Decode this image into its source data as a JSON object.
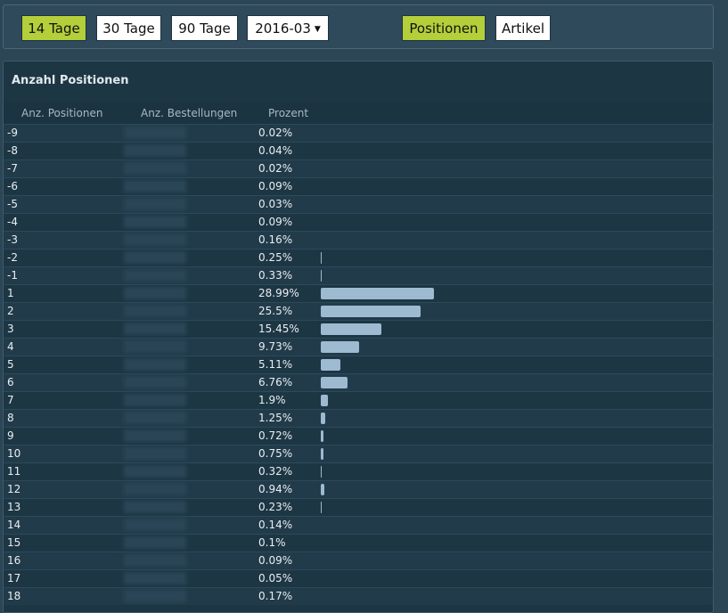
{
  "toolbar": {
    "range_buttons": [
      {
        "label": "14 Tage",
        "active": true
      },
      {
        "label": "30 Tage",
        "active": false
      },
      {
        "label": "90 Tage",
        "active": false
      }
    ],
    "month_select": {
      "value": "2016-03"
    },
    "view_buttons": [
      {
        "label": "Positionen",
        "active": true
      },
      {
        "label": "Artikel",
        "active": false
      }
    ]
  },
  "panel": {
    "title": "Anzahl Positionen",
    "columns": [
      "Anz. Positionen",
      "Anz. Bestellungen",
      "Prozent"
    ]
  },
  "rows": [
    {
      "pos": "-9",
      "count": "3",
      "pct": "0.02%",
      "value": 0.02
    },
    {
      "pos": "-8",
      "count": "7",
      "pct": "0.04%",
      "value": 0.04
    },
    {
      "pos": "-7",
      "count": "4",
      "pct": "0.02%",
      "value": 0.02
    },
    {
      "pos": "-6",
      "count": "15",
      "pct": "0.09%",
      "value": 0.09
    },
    {
      "pos": "-5",
      "count": "5",
      "pct": "0.03%",
      "value": 0.03
    },
    {
      "pos": "-4",
      "count": "16",
      "pct": "0.09%",
      "value": 0.09
    },
    {
      "pos": "-3",
      "count": "28",
      "pct": "0.16%",
      "value": 0.16
    },
    {
      "pos": "-2",
      "count": "42",
      "pct": "0.25%",
      "value": 0.25
    },
    {
      "pos": "-1",
      "count": "56",
      "pct": "0.33%",
      "value": 0.33
    },
    {
      "pos": "1",
      "count": "4951",
      "pct": "28.99%",
      "value": 28.99
    },
    {
      "pos": "2",
      "count": "4354",
      "pct": "25.5%",
      "value": 25.5
    },
    {
      "pos": "3",
      "count": "2639",
      "pct": "15.45%",
      "value": 15.45
    },
    {
      "pos": "4",
      "count": "1662",
      "pct": "9.73%",
      "value": 9.73
    },
    {
      "pos": "5",
      "count": "873",
      "pct": "5.11%",
      "value": 5.11
    },
    {
      "pos": "6",
      "count": "1155",
      "pct": "6.76%",
      "value": 6.76
    },
    {
      "pos": "7",
      "count": "325",
      "pct": "1.9%",
      "value": 1.9
    },
    {
      "pos": "8",
      "count": "213",
      "pct": "1.25%",
      "value": 1.25
    },
    {
      "pos": "9",
      "count": "123",
      "pct": "0.72%",
      "value": 0.72
    },
    {
      "pos": "10",
      "count": "128",
      "pct": "0.75%",
      "value": 0.75
    },
    {
      "pos": "11",
      "count": "55",
      "pct": "0.32%",
      "value": 0.32
    },
    {
      "pos": "12",
      "count": "160",
      "pct": "0.94%",
      "value": 0.94
    },
    {
      "pos": "13",
      "count": "39",
      "pct": "0.23%",
      "value": 0.23
    },
    {
      "pos": "14",
      "count": "24",
      "pct": "0.14%",
      "value": 0.14
    },
    {
      "pos": "15",
      "count": "17",
      "pct": "0.1%",
      "value": 0.1
    },
    {
      "pos": "16",
      "count": "15",
      "pct": "0.09%",
      "value": 0.09
    },
    {
      "pos": "17",
      "count": "9",
      "pct": "0.05%",
      "value": 0.05
    },
    {
      "pos": "18",
      "count": "29",
      "pct": "0.17%",
      "value": 0.17
    }
  ],
  "colors": {
    "active_button": "#b3cf3a",
    "bar": "#9dbad0",
    "background": "#2c4656"
  }
}
